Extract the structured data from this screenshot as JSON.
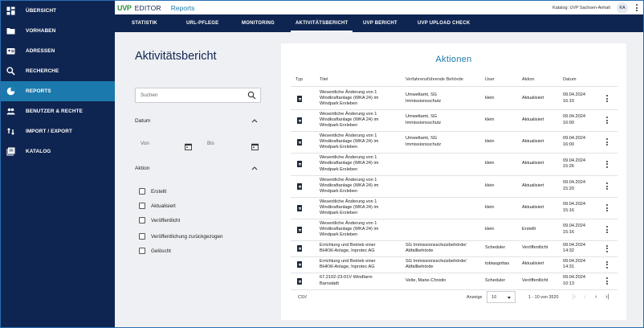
{
  "sidebar": {
    "items": [
      {
        "label": "ÜBERSICHT",
        "icon": "dashboard-icon",
        "active": false
      },
      {
        "label": "VORHABEN",
        "icon": "folder-icon",
        "active": false
      },
      {
        "label": "ADRESSEN",
        "icon": "contact-card-icon",
        "active": false
      },
      {
        "label": "RECHERCHE",
        "icon": "search-icon",
        "active": false
      },
      {
        "label": "REPORTS",
        "icon": "pie-chart-icon",
        "active": true
      },
      {
        "label": "BENUTZER & RECHTE",
        "icon": "users-icon",
        "active": false
      },
      {
        "label": "IMPORT / EXPORT",
        "icon": "import-export-icon",
        "active": false
      },
      {
        "label": "KATALOG",
        "icon": "catalog-icon",
        "active": false
      }
    ]
  },
  "header": {
    "logo_uvp": "UVP",
    "logo_editor": "EDITOR",
    "title": "Reports",
    "katalog": "Katalog:  UVP Sachsen-Anhalt",
    "avatar": "KA"
  },
  "tabs": [
    {
      "label": "STATISTIK",
      "active": false
    },
    {
      "label": "URL-PFLEGE",
      "active": false
    },
    {
      "label": "MONITORING",
      "active": false
    },
    {
      "label": "AKTIVITÄTSBERICHT",
      "active": true
    },
    {
      "label": "UVP BERICHT",
      "active": false
    },
    {
      "label": "UVP UPLOAD CHECK",
      "active": false
    }
  ],
  "filters": {
    "page_title": "Aktivitätsbericht",
    "search_placeholder": "Suchen",
    "datum_label": "Datum",
    "von_label": "Von",
    "bis_label": "Bis",
    "aktion_label": "Aktion",
    "checkboxes": [
      "Erstellt",
      "Aktualisiert",
      "Veröffentlicht",
      "Veröffentlichung zurückgezogen",
      "Gelöscht"
    ]
  },
  "table": {
    "title": "Aktionen",
    "headers": {
      "typ": "Typ",
      "titel": "Titel",
      "behoerde": "Verfahrensführende Behörde",
      "user": "User",
      "aktion": "Aktion",
      "datum": "Datum"
    },
    "rows": [
      {
        "titel": [
          "Wesentliche Änderung von 1",
          "Windkraftanlage (WKA 24) im",
          "Windpark Erxleben"
        ],
        "behoerde": [
          "Umweltamt, SG",
          "Immissionsschutz"
        ],
        "user": "klein",
        "aktion": "Aktualisiert",
        "datum": [
          "09.04.2024",
          "16:10"
        ]
      },
      {
        "titel": [
          "Wesentliche Änderung von 1",
          "Windkraftanlage (WKA 24) im",
          "Windpark Erxleben"
        ],
        "behoerde": [
          "Umweltamt, SG",
          "Immissionsschutz"
        ],
        "user": "klein",
        "aktion": "Aktualisiert",
        "datum": [
          "09.04.2024",
          "16:00"
        ]
      },
      {
        "titel": [
          "Wesentliche Änderung von 1",
          "Windkraftanlage (WKA 24) im",
          "Windpark Erxleben"
        ],
        "behoerde": [
          "Umweltamt, SG",
          "Immissionsschutz"
        ],
        "user": "klein",
        "aktion": "Aktualisiert",
        "datum": [
          "09.04.2024",
          "16:00"
        ]
      },
      {
        "titel": [
          "Wesentliche Änderung von 1",
          "Windkraftanlage (WKA 24) im",
          "Windpark Erxleben"
        ],
        "behoerde": [],
        "user": "klein",
        "aktion": "Aktualisiert",
        "datum": [
          "09.04.2024",
          "15:26"
        ]
      },
      {
        "titel": [
          "Wesentliche Änderung von 1",
          "Windkraftanlage (WKA 24) im",
          "Windpark Erxleben"
        ],
        "behoerde": [],
        "user": "klein",
        "aktion": "Aktualisiert",
        "datum": [
          "09.04.2024",
          "15:20"
        ]
      },
      {
        "titel": [
          "Wesentliche Änderung von 1",
          "Windkraftanlage (WKA 24) im",
          "Windpark Erxleben"
        ],
        "behoerde": [],
        "user": "klein",
        "aktion": "Aktualisiert",
        "datum": [
          "09.04.2024",
          "15:16"
        ]
      },
      {
        "titel": [
          "Wesentliche Änderung von 1",
          "Windkraftanlage (WKA 24) im",
          "Windpark Erxleben"
        ],
        "behoerde": [],
        "user": "klein",
        "aktion": "Erstellt",
        "datum": [
          "09.04.2024",
          "15:16"
        ]
      },
      {
        "titel": [
          "Errichtung und Betrieb einer",
          "BHKW-Anlage, Inprotec AG"
        ],
        "behoerde": [
          "SG Immissionsschutzbehörde/",
          "Abfallbehörde"
        ],
        "user": "Scheduler",
        "aktion": "Veröffentlicht",
        "datum": [
          "09.04.2024",
          "14:32"
        ]
      },
      {
        "titel": [
          "Errichtung und Betrieb einer",
          "BHKW-Anlage, Inprotec AG"
        ],
        "behoerde": [
          "SG Immissionsschutzbehörde/",
          "Abfallbehörde"
        ],
        "user": "tobiasgottas",
        "aktion": "Aktualisiert",
        "datum": [
          "09.04.2024",
          "14:31"
        ]
      },
      {
        "titel": [
          "67.2102-23-01V Windfarm",
          "Barnstädt"
        ],
        "behoerde": [
          "Velte, Marie-Christin"
        ],
        "user": "Scheduler",
        "aktion": "Veröffentlicht",
        "datum": [
          "09.04.2024",
          "10:13"
        ]
      }
    ]
  },
  "footer": {
    "csv": "CSV",
    "anzeige_label": "Anzeige",
    "page_size": "10",
    "range": "1 - 10 von 3520",
    "first_icon": "first-page-icon",
    "prev_icon": "prev-page-icon",
    "next_icon": "next-page-icon",
    "last_icon": "last-page-icon"
  },
  "colors": {
    "sidebar": "#0f2551",
    "active": "#1b79ad",
    "logo_green": "#2f8f3f",
    "content_bg": "#eef0f3"
  }
}
